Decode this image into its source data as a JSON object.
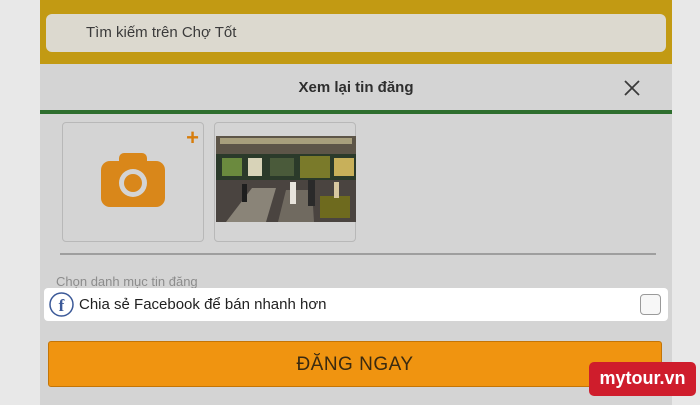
{
  "search": {
    "placeholder": "Tìm kiếm trên Chợ Tốt"
  },
  "modal": {
    "title": "Xem lại tin đăng",
    "category_label": "Chọn danh mục tin đăng"
  },
  "photos": {
    "add_symbol": "+"
  },
  "facebook_share": {
    "label": "Chia sẻ Facebook để bán nhanh hơn",
    "checked": false
  },
  "submit": {
    "label": "ĐĂNG NGAY"
  },
  "watermark": {
    "text": "mytour.vn"
  },
  "colors": {
    "accent": "#f09410",
    "topbar": "#c29a13",
    "watermark": "#cf1d2c",
    "facebook": "#3b5998"
  },
  "icons": [
    "close-icon",
    "camera-icon",
    "facebook-icon"
  ]
}
